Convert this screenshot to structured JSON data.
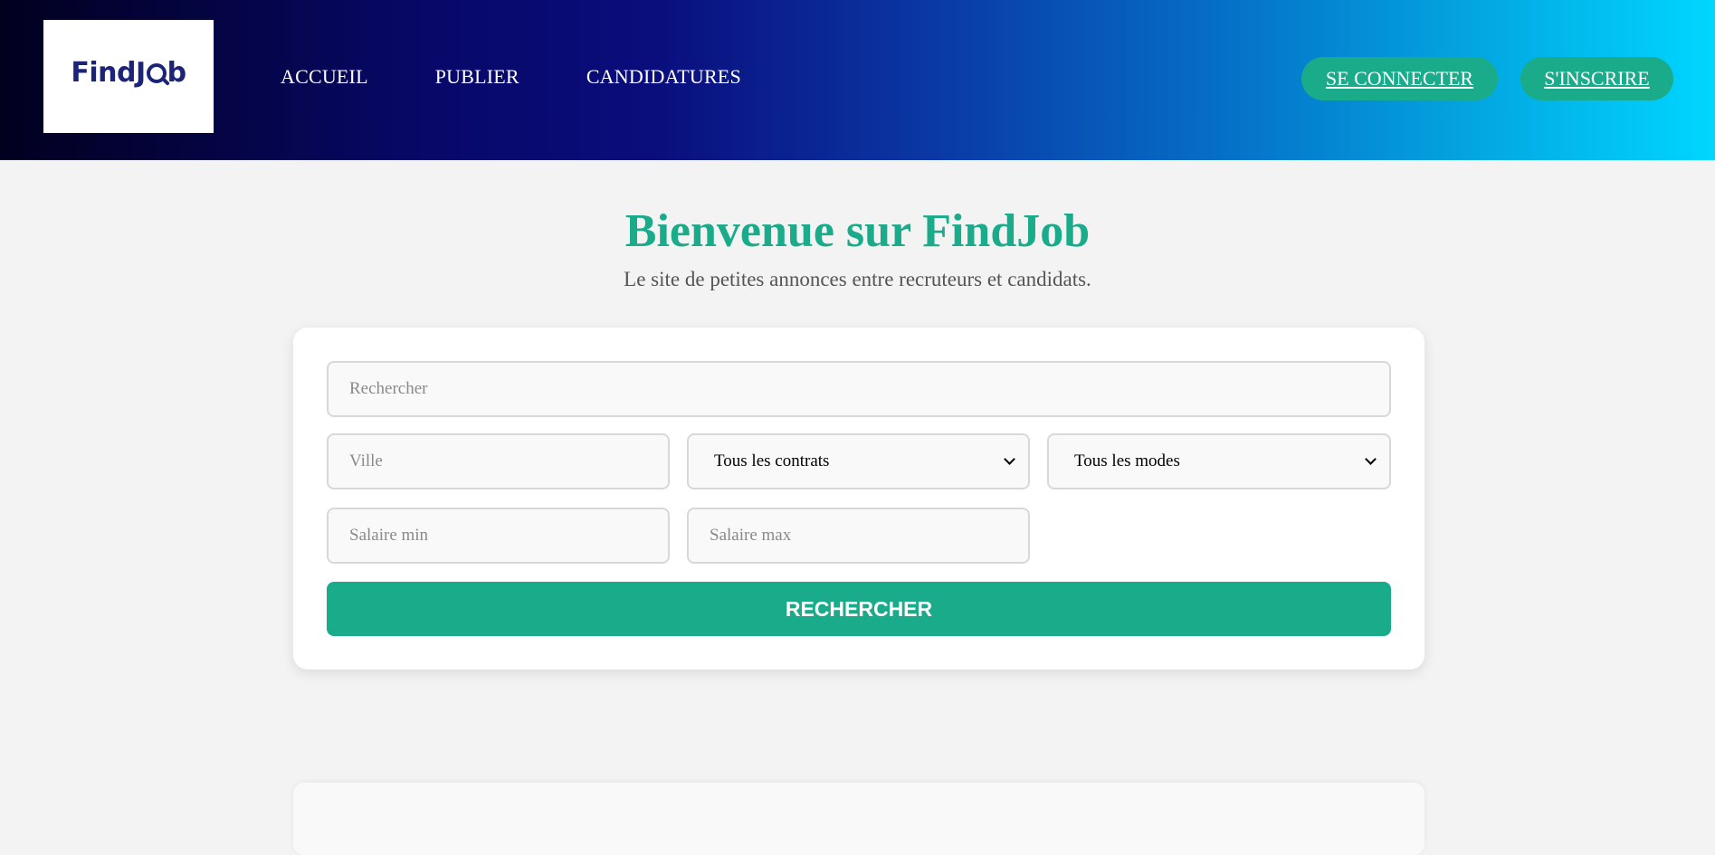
{
  "header": {
    "logo": {
      "text_before": "FindJ",
      "text_after": "b"
    },
    "nav": [
      {
        "label": "ACCUEIL"
      },
      {
        "label": "PUBLIER"
      },
      {
        "label": "CANDIDATURES"
      }
    ],
    "login_label": "SE CONNECTER",
    "signup_label": "S'INSCRIRE"
  },
  "hero": {
    "title": "Bienvenue sur FindJob",
    "subtitle": "Le site de petites annonces entre recruteurs et candidats."
  },
  "search": {
    "query_placeholder": "Rechercher",
    "city_placeholder": "Ville",
    "contract_selected": "Tous les contrats",
    "mode_selected": "Tous les modes",
    "salary_min_placeholder": "Salaire min",
    "salary_max_placeholder": "Salaire max",
    "submit_label": "RECHERCHER"
  },
  "colors": {
    "accent": "#1aab8a",
    "logo": "#1b2478",
    "header_gradient_start": "#02001f",
    "header_gradient_end": "#00d6ff"
  }
}
